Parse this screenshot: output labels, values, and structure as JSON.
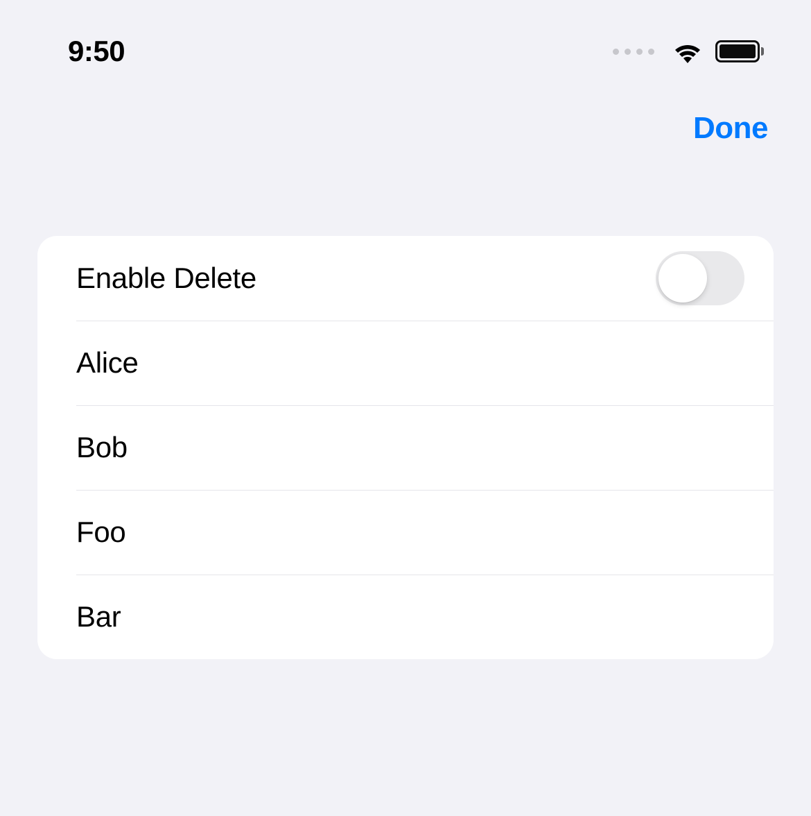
{
  "status_bar": {
    "time": "9:50"
  },
  "nav": {
    "done_label": "Done"
  },
  "list": {
    "toggle_row": {
      "label": "Enable Delete",
      "value": false
    },
    "items": [
      {
        "label": "Alice"
      },
      {
        "label": "Bob"
      },
      {
        "label": "Foo"
      },
      {
        "label": "Bar"
      }
    ]
  }
}
